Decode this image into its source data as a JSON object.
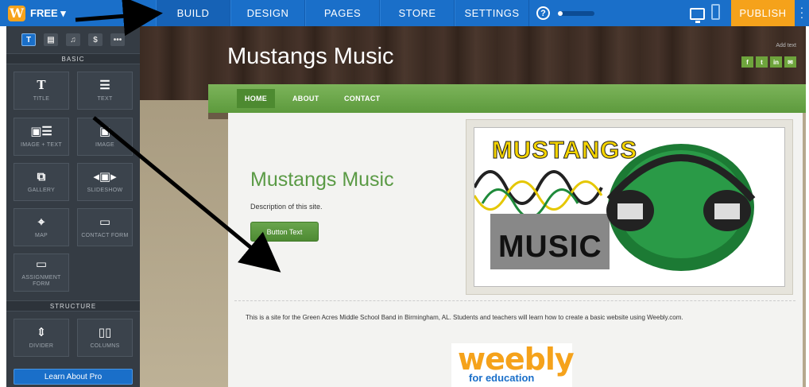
{
  "topbar": {
    "logo_letter": "W",
    "plan_label": "FREE ▾",
    "tabs": [
      {
        "label": "BUILD"
      },
      {
        "label": "DESIGN"
      },
      {
        "label": "PAGES"
      },
      {
        "label": "STORE"
      },
      {
        "label": "SETTINGS"
      }
    ],
    "help_glyph": "?",
    "progress_fraction": 0.12,
    "publish_label": "PUBLISH",
    "colors": {
      "bar": "#1a6fc9",
      "publish": "#f5a21b"
    }
  },
  "sidebar": {
    "categories": [
      {
        "icon": "text-category-icon",
        "glyph": "T"
      },
      {
        "icon": "layout-category-icon",
        "glyph": "▤"
      },
      {
        "icon": "music-category-icon",
        "glyph": "♫"
      },
      {
        "icon": "dollar-category-icon",
        "glyph": "$"
      },
      {
        "icon": "more-category-icon",
        "glyph": "•••"
      }
    ],
    "basic_label": "BASIC",
    "structure_label": "STRUCTURE",
    "basic_elements": [
      {
        "label": "TITLE",
        "glyph": "T",
        "icon": "title-icon"
      },
      {
        "label": "TEXT",
        "glyph": "☰",
        "icon": "text-lines-icon"
      },
      {
        "label": "IMAGE + TEXT",
        "glyph": "▣☰",
        "icon": "image-text-icon"
      },
      {
        "label": "IMAGE",
        "glyph": "▣",
        "icon": "image-icon"
      },
      {
        "label": "GALLERY",
        "glyph": "⧉",
        "icon": "gallery-icon"
      },
      {
        "label": "SLIDESHOW",
        "glyph": "◂▣▸",
        "icon": "slideshow-icon"
      },
      {
        "label": "MAP",
        "glyph": "⌖",
        "icon": "map-icon"
      },
      {
        "label": "CONTACT FORM",
        "glyph": "▭",
        "icon": "contact-form-icon"
      },
      {
        "label": "ASSIGNMENT FORM",
        "glyph": "▭",
        "icon": "assignment-form-icon"
      }
    ],
    "structure_elements": [
      {
        "label": "DIVIDER",
        "glyph": "⇕",
        "icon": "divider-icon"
      },
      {
        "label": "COLUMNS",
        "glyph": "▯▯",
        "icon": "columns-icon"
      }
    ],
    "learn_pro_label": "Learn About Pro"
  },
  "site": {
    "title": "Mustangs Music",
    "add_text": "Add text",
    "social": [
      "f",
      "t",
      "in",
      "✉"
    ],
    "nav": [
      "HOME",
      "ABOUT",
      "CONTACT"
    ],
    "hero_title": "Mustangs Music",
    "hero_description": "Description of this site.",
    "button_text": "Button Text",
    "image_words": {
      "top": "MUSTANGS",
      "bottom": "MUSIC"
    },
    "body_text": "This is a site for the Green Acres Middle School Band in Birmingham, AL.  Students and teachers will learn how to create a basic website using Weebly.com.",
    "logo": {
      "word": "weebly",
      "sub": "for education"
    }
  }
}
